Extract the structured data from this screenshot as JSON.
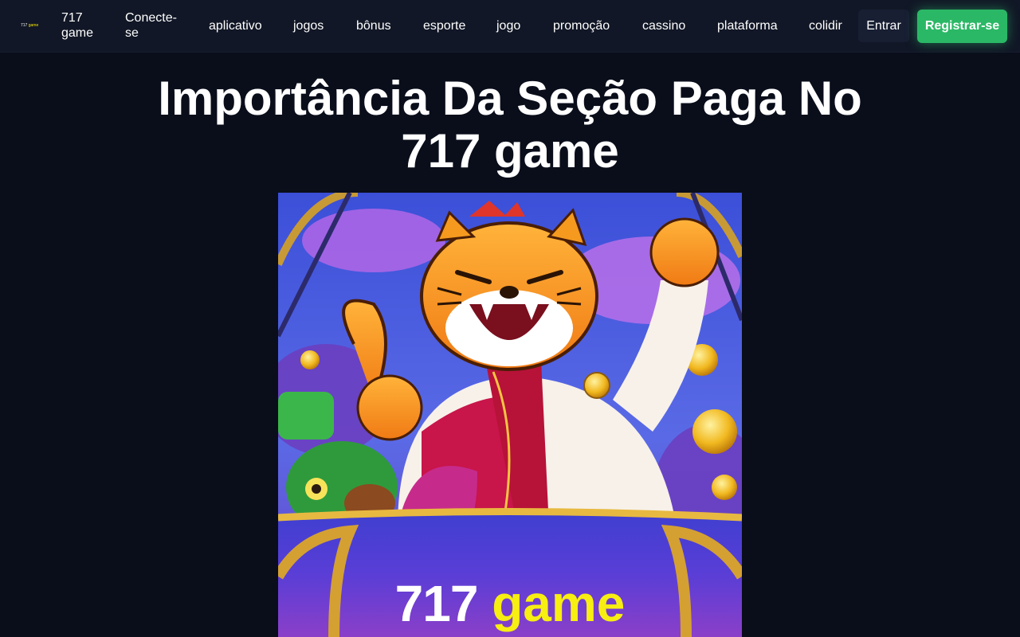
{
  "header": {
    "logo": {
      "number": "717",
      "word": "game"
    },
    "nav": [
      {
        "id": "717-game",
        "label": "717 game"
      },
      {
        "id": "conecte-se",
        "label": "Conecte-se"
      },
      {
        "id": "aplicativo",
        "label": "aplicativo"
      },
      {
        "id": "jogos",
        "label": "jogos"
      },
      {
        "id": "bonus",
        "label": "bônus"
      },
      {
        "id": "esporte",
        "label": "esporte"
      },
      {
        "id": "jogo",
        "label": "jogo"
      },
      {
        "id": "promocao",
        "label": "promoção"
      },
      {
        "id": "cassino",
        "label": "cassino"
      },
      {
        "id": "plataforma",
        "label": "plataforma"
      },
      {
        "id": "colidir",
        "label": "colidir"
      }
    ],
    "login_label": "Entrar",
    "register_label": "Registrar-se"
  },
  "main": {
    "title": "Importância Da Seção Paga No 717 game",
    "hero": {
      "caption_number": "717",
      "caption_word": "game"
    }
  },
  "colors": {
    "background": "#0a0e1b",
    "header": "#111726",
    "register_button": "#2bb866",
    "logo_word": "#f6e400"
  }
}
